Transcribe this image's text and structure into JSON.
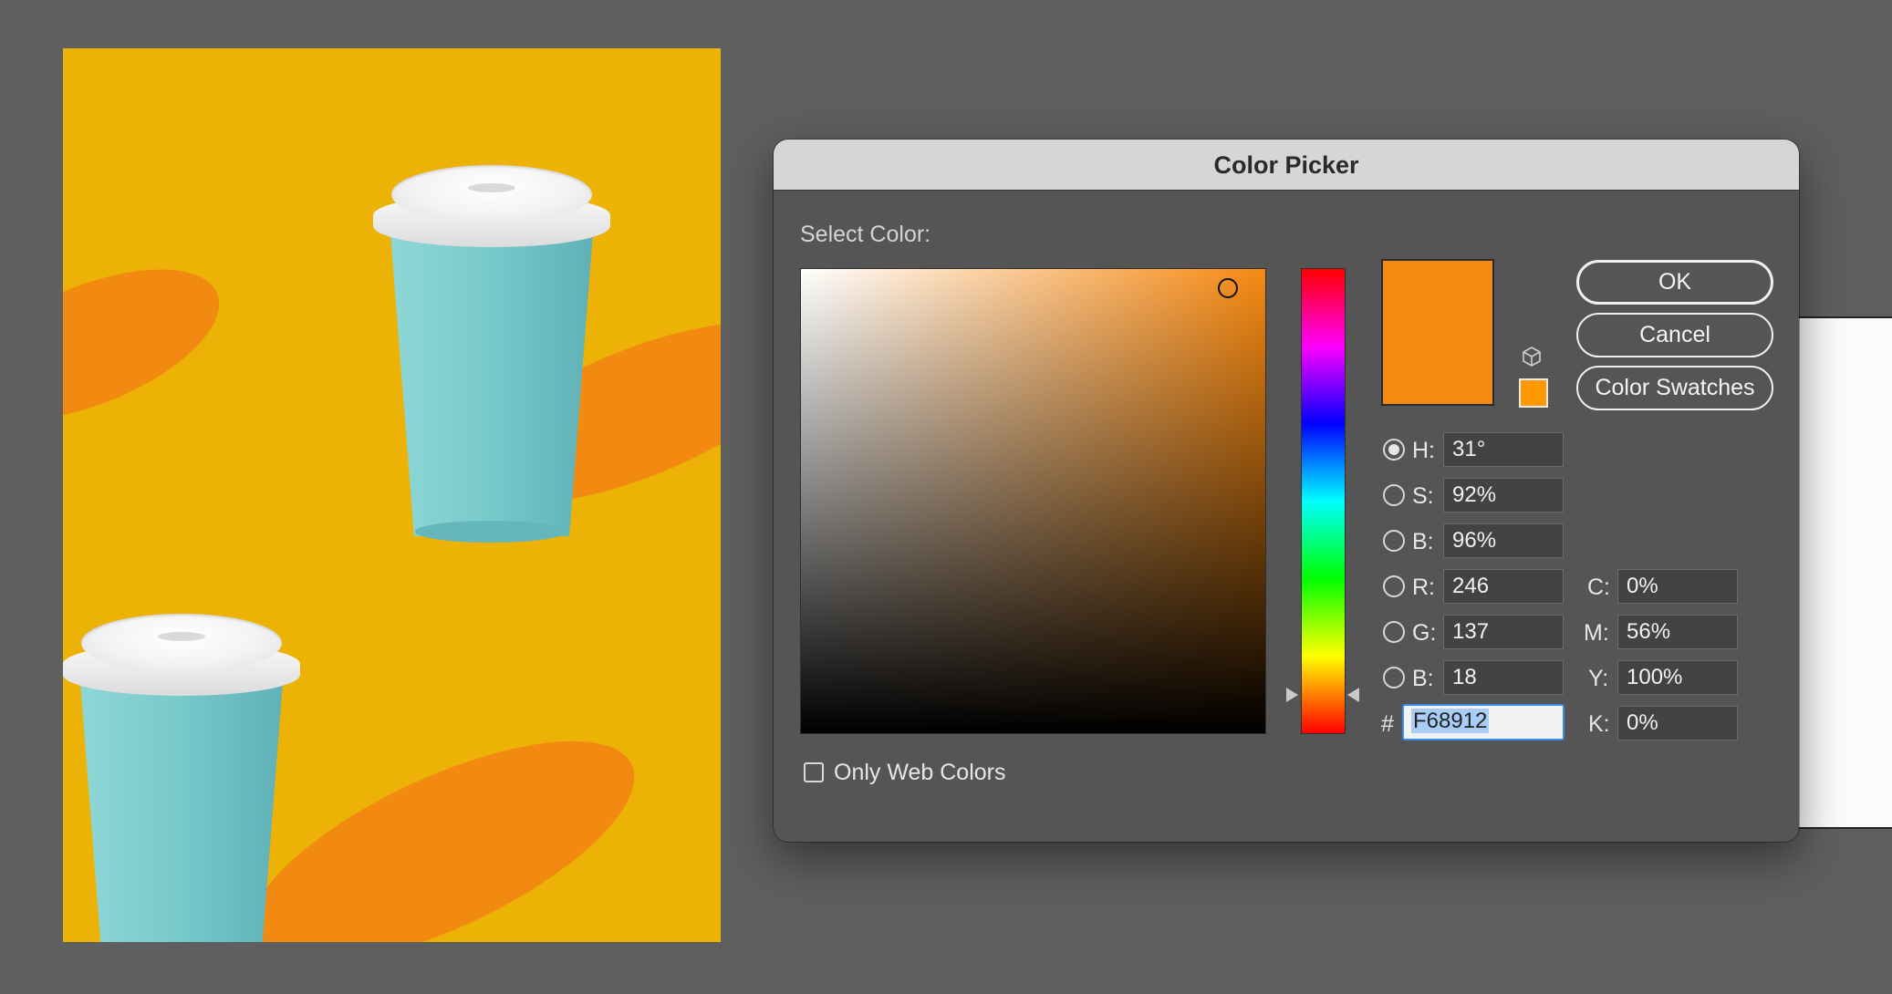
{
  "dialog": {
    "title": "Color Picker",
    "select_label": "Select Color:",
    "buttons": {
      "ok": "OK",
      "cancel": "Cancel",
      "swatches": "Color Swatches"
    },
    "current_color": "#F68912",
    "websafe_color": "#FF9900",
    "hsb": {
      "h": {
        "label": "H:",
        "value": "31°",
        "selected": true
      },
      "s": {
        "label": "S:",
        "value": "92%"
      },
      "b": {
        "label": "B:",
        "value": "96%"
      }
    },
    "rgb": {
      "r": {
        "label": "R:",
        "value": "246"
      },
      "g": {
        "label": "G:",
        "value": "137"
      },
      "b": {
        "label": "B:",
        "value": "18"
      }
    },
    "cmyk": {
      "c": {
        "label": "C:",
        "value": "0%"
      },
      "m": {
        "label": "M:",
        "value": "56%"
      },
      "y": {
        "label": "Y:",
        "value": "100%"
      },
      "k": {
        "label": "K:",
        "value": "0%"
      }
    },
    "hex": {
      "label": "#",
      "value": "F68912"
    },
    "only_web_colors": {
      "label": "Only Web Colors",
      "checked": false
    },
    "icons": {
      "gamut_warning": "cube-icon"
    }
  },
  "canvas": {
    "background_color": "#ECB205",
    "shadow_color": "#F28A12",
    "cup_color": "#7ACBCC"
  }
}
